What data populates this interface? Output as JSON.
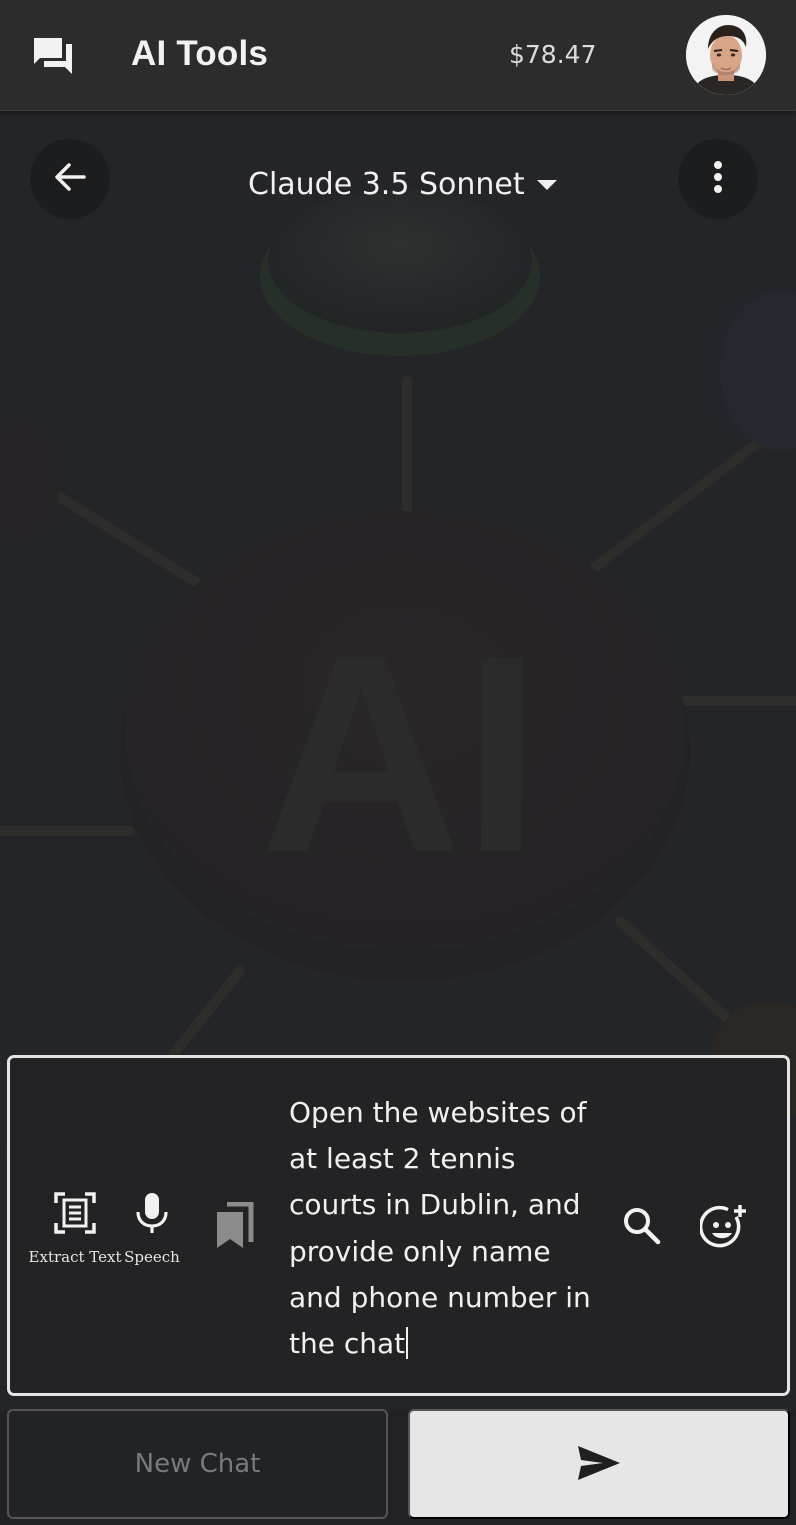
{
  "appbar": {
    "title": "AI Tools",
    "balance": "$78.47",
    "chat_icon": "forum-icon",
    "avatar": "user-avatar"
  },
  "model_header": {
    "model_name": "Claude 3.5 Sonnet",
    "back_icon": "arrow-back-icon",
    "more_icon": "more-vert-icon",
    "dropdown_icon": "caret-down-icon"
  },
  "background": {
    "image": "AI-network-illustration",
    "text": "AI"
  },
  "composer": {
    "tools": [
      {
        "label": "Extract Text",
        "icon": "document-scan-icon"
      },
      {
        "label": "Speech",
        "icon": "microphone-icon"
      }
    ],
    "bookmark_icon": "bookmarks-icon",
    "message": "Open the websites of\nat least 2 tennis\ncourts in Dublin, and\nprovide only name\nand phone number in\nthe chat",
    "search_icon": "search-icon",
    "emoji_icon": "add-reaction-icon"
  },
  "actions": {
    "new_chat_label": "New Chat",
    "send_icon": "send-icon"
  },
  "colors": {
    "appbar": "#2c2c2c",
    "background": "#202124",
    "send_button": "#e6e6e6",
    "composer_border": "#e4e4e4"
  }
}
